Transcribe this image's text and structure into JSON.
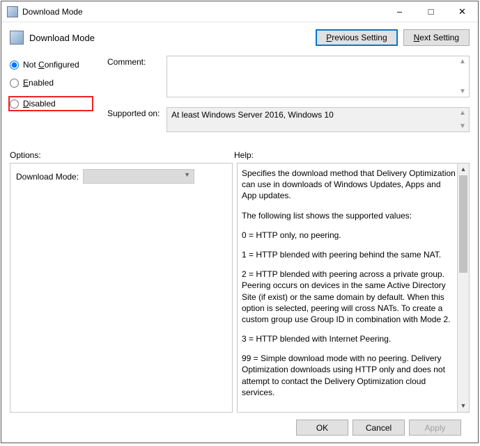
{
  "window": {
    "title": "Download Mode"
  },
  "header": {
    "title": "Download Mode",
    "previous_btn": "Previous Setting",
    "next_btn": "Next Setting"
  },
  "radios": {
    "not_configured": "Not Configured",
    "enabled": "Enabled",
    "disabled": "Disabled"
  },
  "fields": {
    "comment_label": "Comment:",
    "supported_label": "Supported on:",
    "supported_value": "At least Windows Server 2016, Windows 10"
  },
  "labels": {
    "options": "Options:",
    "help": "Help:"
  },
  "options": {
    "download_mode_label": "Download Mode:"
  },
  "help": {
    "p1": "Specifies the download method that Delivery Optimization can use in downloads of Windows Updates, Apps and App updates.",
    "p2": "The following list shows the supported values:",
    "p3": "0 = HTTP only, no peering.",
    "p4": "1 = HTTP blended with peering behind the same NAT.",
    "p5": "2 = HTTP blended with peering across a private group. Peering occurs on devices in the same Active Directory Site (if exist) or the same domain by default. When this option is selected, peering will cross NATs. To create a custom group use Group ID in combination with Mode 2.",
    "p6": "3 = HTTP blended with Internet Peering.",
    "p7": "99 = Simple download mode with no peering. Delivery Optimization downloads using HTTP only and does not attempt to contact the Delivery Optimization cloud services."
  },
  "footer": {
    "ok": "OK",
    "cancel": "Cancel",
    "apply": "Apply"
  }
}
